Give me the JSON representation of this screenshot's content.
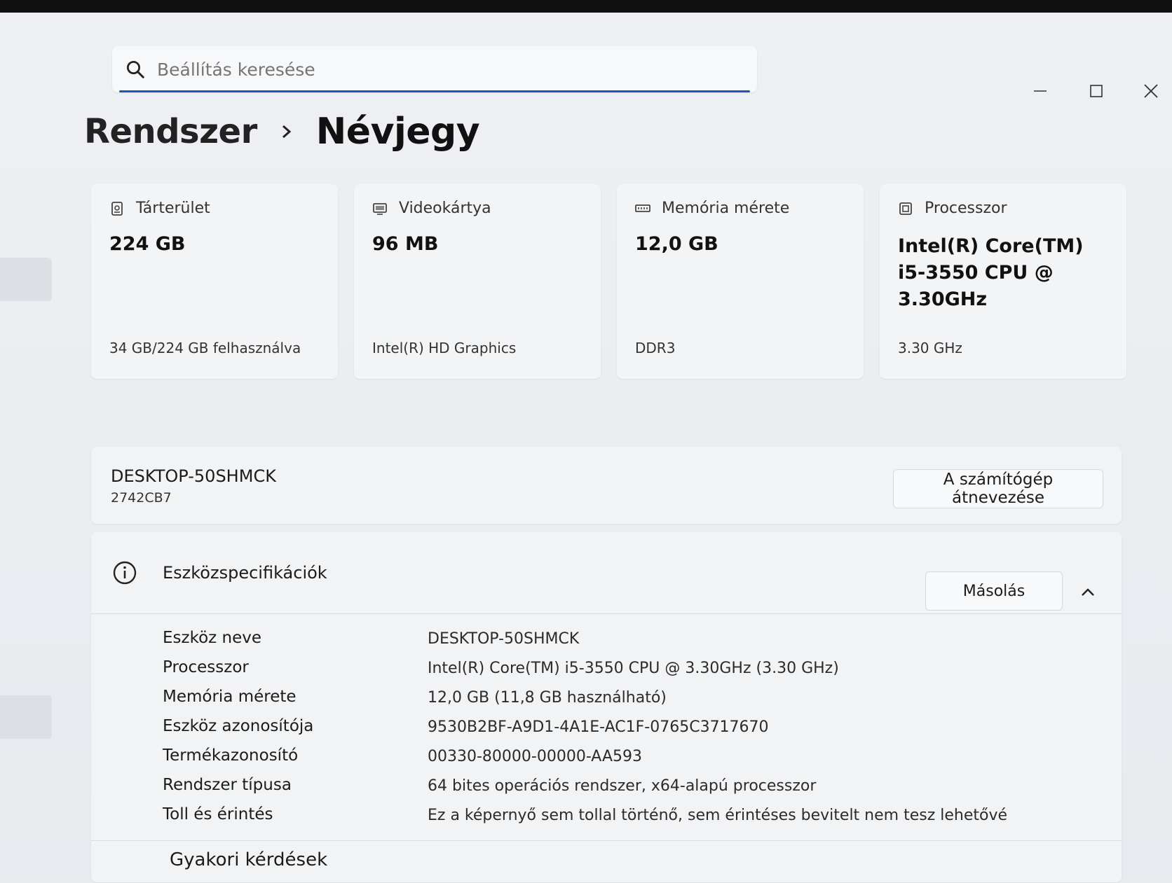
{
  "search": {
    "placeholder": "Beállítás keresése"
  },
  "breadcrumb": {
    "parent": "Rendszer",
    "current": "Névjegy"
  },
  "cards": [
    {
      "label": "Tárterület",
      "icon": "storage-icon",
      "value": "224 GB",
      "footer": "34 GB/224 GB felhasználva"
    },
    {
      "label": "Videokártya",
      "icon": "display-adapter-icon",
      "value": "96 MB",
      "footer": "Intel(R) HD Graphics"
    },
    {
      "label": "Memória mérete",
      "icon": "memory-icon",
      "value": "12,0 GB",
      "footer": "DDR3"
    },
    {
      "label": "Processzor",
      "icon": "processor-icon",
      "value": "Intel(R) Core(TM) i5-3550 CPU @ 3.30GHz",
      "footer": "3.30 GHz"
    }
  ],
  "device": {
    "name": "DESKTOP-50SHMCK",
    "id": "2742CB7",
    "rename_label": "A számítógép átnevezése"
  },
  "specs": {
    "title": "Eszközspecifikációk",
    "copy_label": "Másolás",
    "rows": [
      {
        "label": "Eszköz neve",
        "value": "DESKTOP-50SHMCK"
      },
      {
        "label": "Processzor",
        "value": "Intel(R) Core(TM) i5-3550 CPU @ 3.30GHz (3.30 GHz)"
      },
      {
        "label": "Memória mérete",
        "value": "12,0 GB (11,8 GB használható)"
      },
      {
        "label": "Eszköz azonosítója",
        "value": "9530B2BF-A9D1-4A1E-AC1F-0765C3717670"
      },
      {
        "label": "Termékazonosító",
        "value": "00330-80000-00000-AA593"
      },
      {
        "label": "Rendszer típusa",
        "value": "64 bites operációs rendszer, x64-alapú processzor"
      },
      {
        "label": "Toll és érintés",
        "value": "Ez a képernyő sem tollal történő, sem érintéses bevitelt nem tesz lehetővé"
      }
    ]
  },
  "faq": {
    "title": "Gyakori kérdések"
  },
  "colors": {
    "accent": "#1f56b5",
    "background": "#e9ebee",
    "card": "#f3f4f6"
  }
}
